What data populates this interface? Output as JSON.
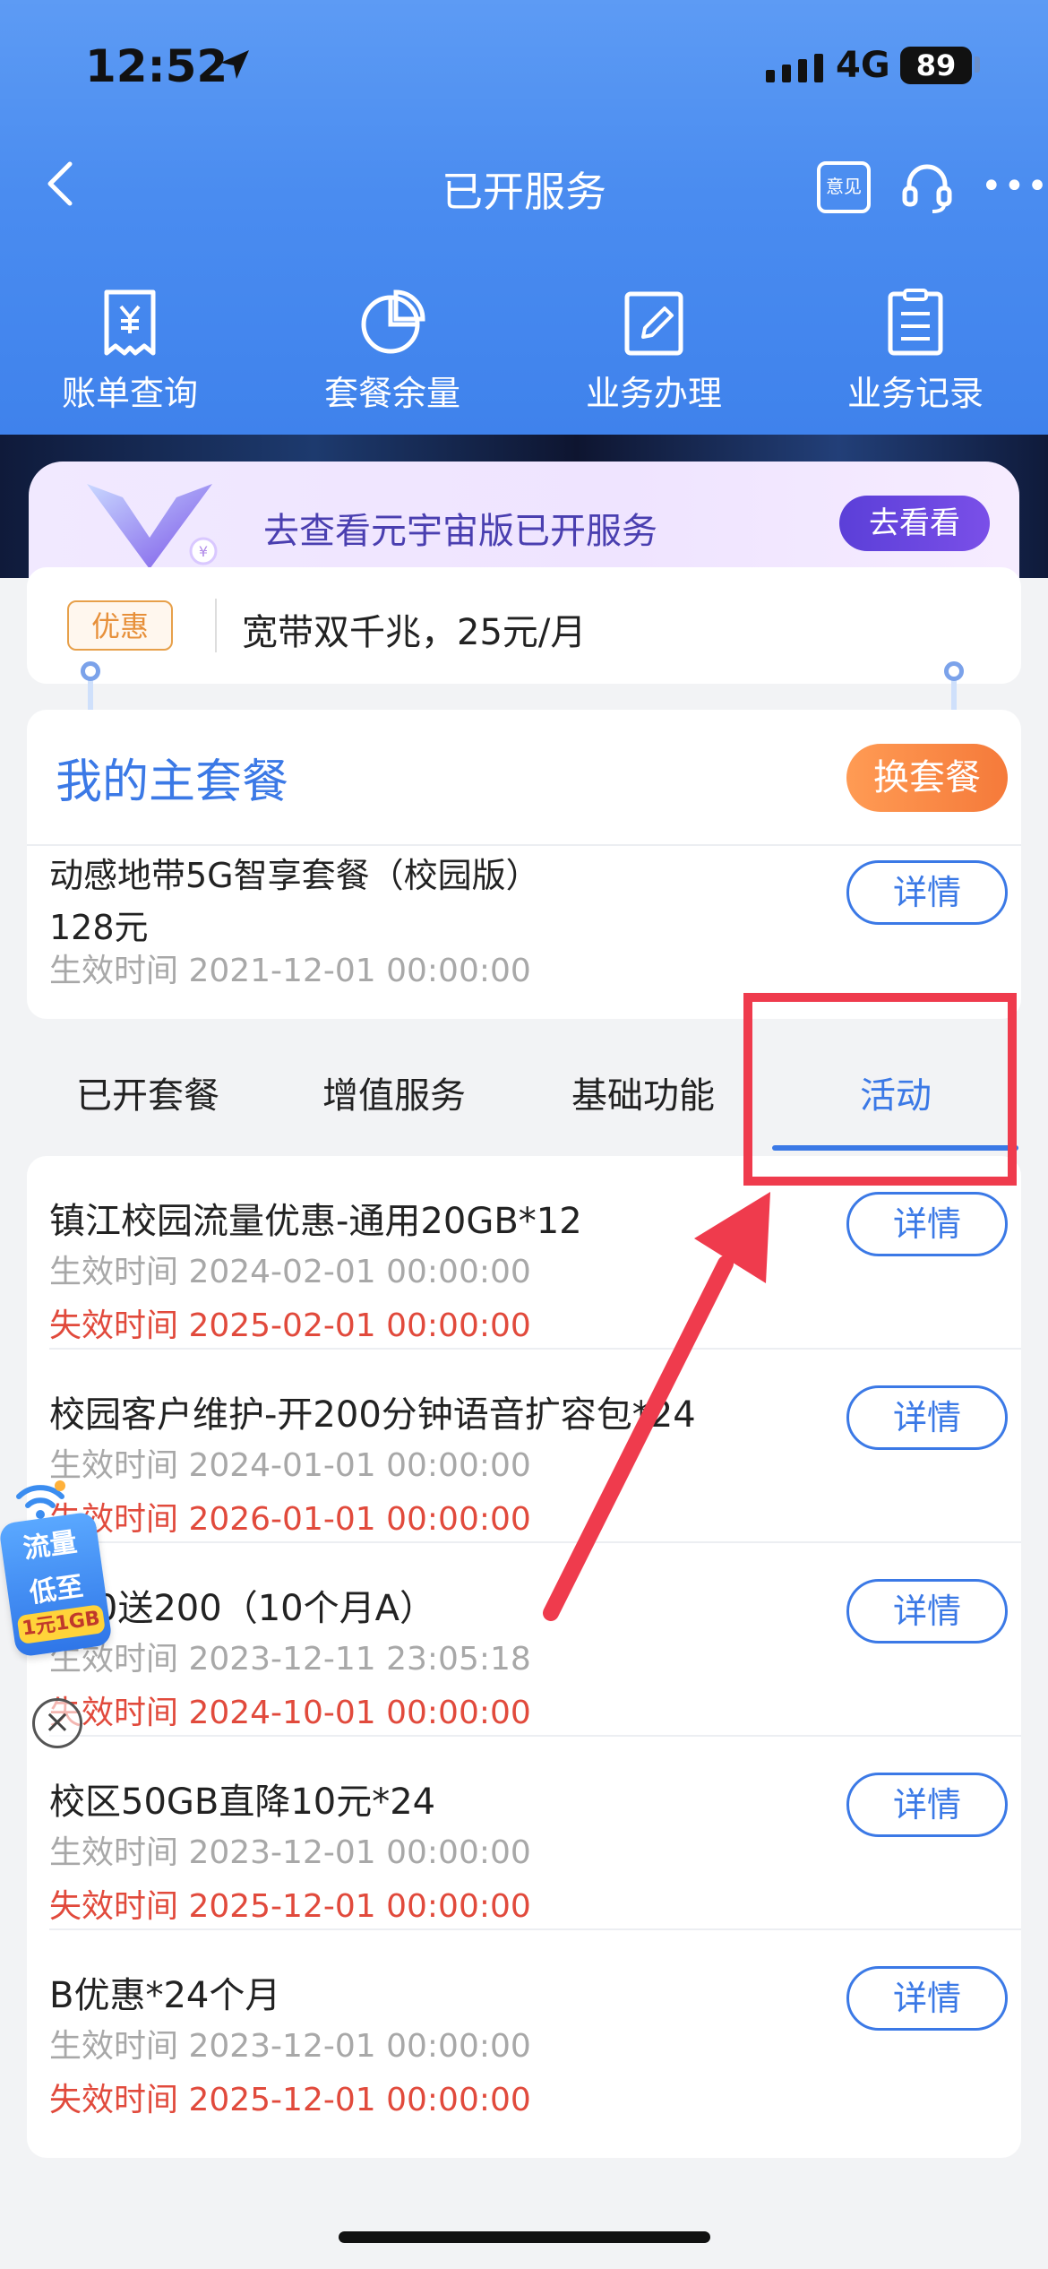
{
  "status_bar": {
    "time": "12:52",
    "network": "4G",
    "battery": "89"
  },
  "nav": {
    "title": "已开服务",
    "feedback_label": "意见"
  },
  "quick_actions": [
    {
      "label": "账单查询",
      "icon": "receipt-icon"
    },
    {
      "label": "套餐余量",
      "icon": "pie-chart-icon"
    },
    {
      "label": "业务办理",
      "icon": "edit-form-icon"
    },
    {
      "label": "业务记录",
      "icon": "list-document-icon"
    }
  ],
  "metaverse_banner": {
    "text": "去查看元宇宙版已开服务",
    "button": "去看看"
  },
  "promo": {
    "tag": "优惠",
    "text": "宽带双千兆，25元/月"
  },
  "main_plan": {
    "title": "我的主套餐",
    "change_button": "换套餐",
    "name": "动感地带5G智享套餐（校园版）",
    "price": "128元",
    "effective": "生效时间 2021-12-01  00:00:00",
    "detail_button": "详情"
  },
  "tabs": [
    {
      "label": "已开套餐",
      "active": false
    },
    {
      "label": "增值服务",
      "active": false
    },
    {
      "label": "基础功能",
      "active": false
    },
    {
      "label": "活动",
      "active": true
    }
  ],
  "activities": [
    {
      "title": "镇江校园流量优惠-通用20GB*12",
      "start": "生效时间 2024-02-01 00:00:00",
      "end": "失效时间 2025-02-01 00:00:00",
      "detail": "详情"
    },
    {
      "title": "校园客户维护-开200分钟语音扩容包*24",
      "start": "生效时间 2024-01-01 00:00:00",
      "end": "失效时间 2026-01-01 00:00:00",
      "detail": "详情"
    },
    {
      "title": "200送200（10个月A）",
      "start": "生效时间 2023-12-11 23:05:18",
      "end": "失效时间 2024-10-01 00:00:00",
      "detail": "详情"
    },
    {
      "title": "校区50GB直降10元*24",
      "start": "生效时间 2023-12-01 00:00:00",
      "end": "失效时间 2025-12-01 00:00:00",
      "detail": "详情"
    },
    {
      "title": "B优惠*24个月",
      "start": "生效时间 2023-12-01 00:00:00",
      "end": "失效时间 2025-12-01 00:00:00",
      "detail": "详情"
    }
  ],
  "float_ad": {
    "line1": "流量",
    "line2": "低至",
    "line3": "1元1GB"
  },
  "colors": {
    "accent": "#3b79e6",
    "orange": "#f57a3a",
    "expired_red": "#e14a3c",
    "annotation_red": "#ef3b4d"
  }
}
